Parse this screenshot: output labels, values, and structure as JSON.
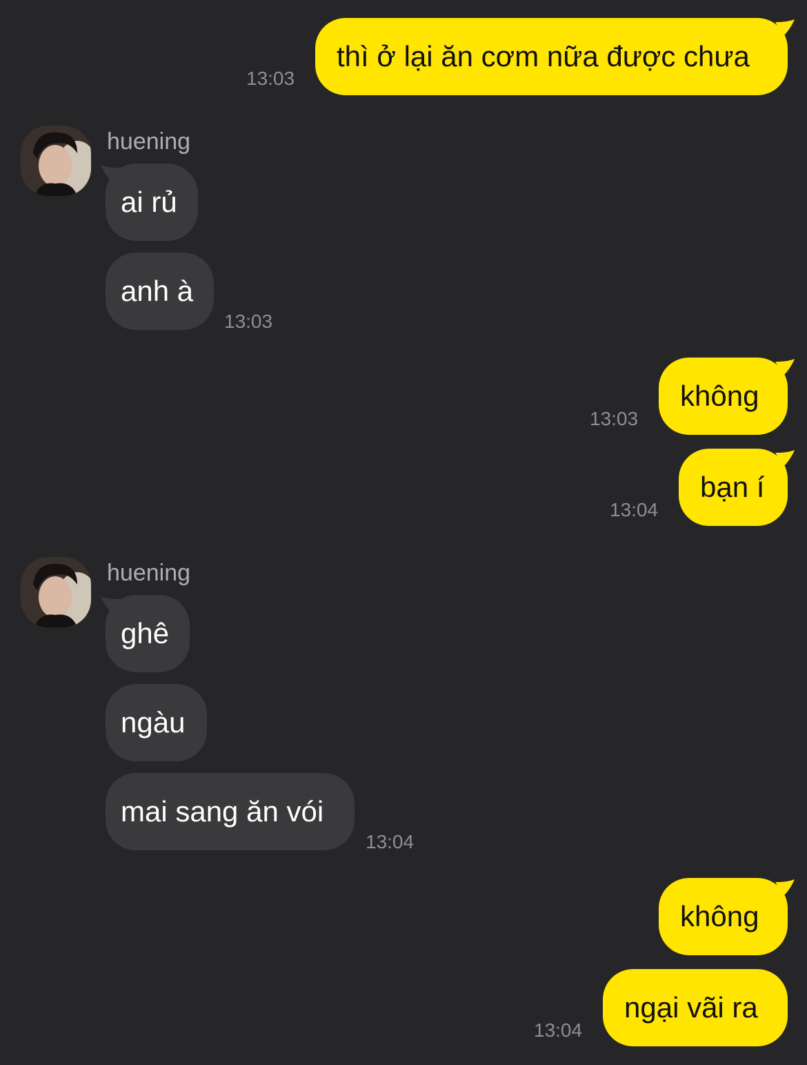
{
  "chat": {
    "contact_name": "huening",
    "messages": [
      {
        "text": "thì ở lại ăn cơm nữa được chưa",
        "time": "13:03"
      },
      {
        "text": "ai rủ"
      },
      {
        "text": "anh à",
        "time": "13:03"
      },
      {
        "text": "không",
        "time": "13:03"
      },
      {
        "text": "bạn í",
        "time": "13:04"
      },
      {
        "text": "ghê"
      },
      {
        "text": "ngàu"
      },
      {
        "text": "mai sang ăn vói",
        "time": "13:04"
      },
      {
        "text": "không"
      },
      {
        "text": "ngại vãi ra",
        "time": "13:04"
      }
    ]
  },
  "colors": {
    "background": "#262628",
    "outgoing_bubble": "#FFE500",
    "incoming_bubble": "#3A3A3C",
    "timestamp": "#8E8E93"
  }
}
